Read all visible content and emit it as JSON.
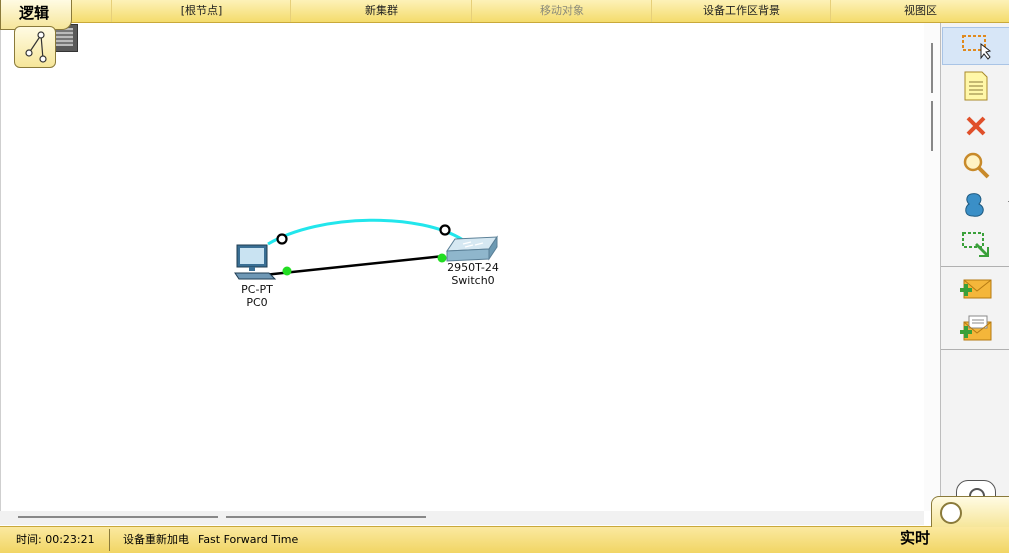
{
  "topbar": {
    "logic_tab": "逻辑",
    "nav": [
      {
        "label": "[根节点]",
        "enabled": true
      },
      {
        "label": "新集群",
        "enabled": true
      },
      {
        "label": "移动对象",
        "enabled": false
      },
      {
        "label": "设备工作区背景",
        "enabled": true
      },
      {
        "label": "视图区",
        "enabled": true
      }
    ]
  },
  "devices": [
    {
      "model": "PC-PT",
      "name": "PC0",
      "icon": "pc-icon"
    },
    {
      "model": "2950T-24",
      "name": "Switch0",
      "icon": "switch-icon"
    }
  ],
  "links": [
    {
      "from": "PC0",
      "to": "Switch0",
      "type": "console-cable",
      "color": "#22e6ec"
    },
    {
      "from": "PC0",
      "to": "Switch0",
      "type": "straight-through",
      "color": "#000000",
      "port_status": "up",
      "port_color": "#22dd22"
    }
  ],
  "sidebar": {
    "tools": [
      "select-icon",
      "note-icon",
      "delete-icon",
      "inspect-icon",
      "draw-shape-icon",
      "resize-icon",
      "add-simple-pdu-icon",
      "add-complex-pdu-icon"
    ],
    "selected": "select-icon"
  },
  "statusbar": {
    "time_label": "时间: 00:23:21",
    "power_cycle": "设备重新加电",
    "fast_forward": "Fast Forward Time",
    "mode": "实时"
  },
  "colors": {
    "bar": "#f4dc6c",
    "console_cable": "#22e6ec",
    "link_up": "#22dd22"
  }
}
